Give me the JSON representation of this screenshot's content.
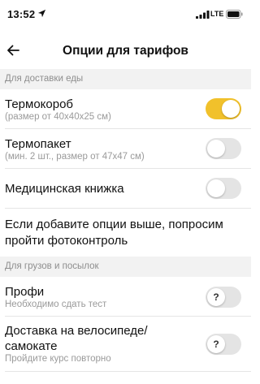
{
  "status_bar": {
    "time": "13:52",
    "carrier": "LTE",
    "icons": [
      "location-arrow-icon",
      "signal-bars-icon",
      "battery-icon"
    ]
  },
  "nav": {
    "title": "Опции для тарифов",
    "back_icon": "arrow-left-icon"
  },
  "sections": {
    "food": {
      "header": "Для доставки еды",
      "items": [
        {
          "title": "Термокороб",
          "subtitle": "(размер от 40х40х25 см)",
          "enabled": true
        },
        {
          "title": "Термопакет",
          "subtitle": "(мин. 2 шт., размер от 47х47 см)",
          "enabled": false
        },
        {
          "title": "Медицинская книжка",
          "enabled": false
        }
      ],
      "note": "Если добавите опции выше, попросим пройти фотоконтроль"
    },
    "cargo": {
      "header": "Для грузов и посылок",
      "items": [
        {
          "title": "Профи",
          "subtitle": "Необходимо сдать тест",
          "enabled": false,
          "knob_label": "?"
        },
        {
          "title": "Доставка на велосипеде/ самокате",
          "subtitle": "Пройдите курс повторно",
          "enabled": false,
          "knob_label": "?"
        }
      ]
    }
  },
  "colors": {
    "accent": "#f1c12b",
    "section_bg": "#f2f2f2",
    "subtitle": "#9a9a9a",
    "toggle_off": "#e4e4e4"
  }
}
